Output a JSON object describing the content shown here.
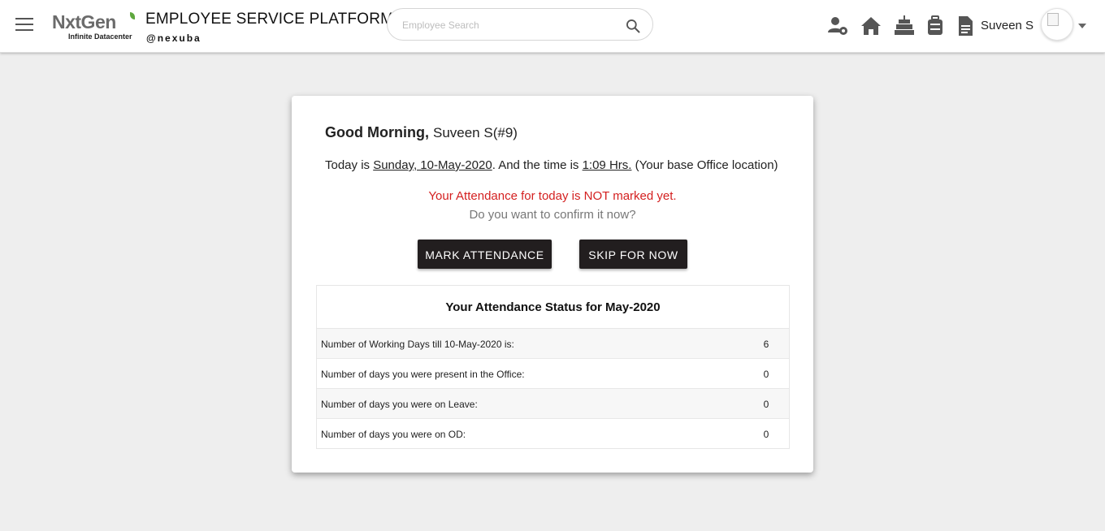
{
  "header": {
    "logo_main": "NxtGen",
    "logo_tagline": "Infinite Datacenter",
    "title": "EMPLOYEE SERVICE PLATFORM",
    "subtitle": "@nexuba",
    "search_placeholder": "Employee Search",
    "search_value": "",
    "user_name": "Suveen S",
    "icons": [
      "user-settings-icon",
      "home-icon",
      "birthday-cake-icon",
      "luggage-icon",
      "document-icon"
    ]
  },
  "card": {
    "greeting": "Good Morning,",
    "employee": "Suveen S(#9)",
    "today_prefix": "Today is ",
    "date": "Sunday, 10-May-2020",
    "time_prefix": ". And the time is ",
    "time": "1:09 Hrs.",
    "location_note": " (Your base Office location)",
    "not_marked": "Your Attendance for today is NOT marked yet.",
    "confirm_question": "Do you want to confirm it now?",
    "mark_button": "MARK ATTENDANCE",
    "skip_button": "SKIP FOR NOW"
  },
  "status": {
    "title": "Your Attendance Status for May-2020",
    "rows": [
      {
        "label": "Number of Working Days till 10-May-2020 is:",
        "value": "6"
      },
      {
        "label": "Number of days you were present in the Office:",
        "value": "0"
      },
      {
        "label": "Number of days you were on Leave:",
        "value": "0"
      },
      {
        "label": "Number of days you were on OD:",
        "value": "0"
      }
    ]
  },
  "colors": {
    "background": "#eeeeee",
    "button": "#221e1f",
    "alert": "#d42020",
    "brand_green": "#5ea73d",
    "brand_gray": "#6b6b6b"
  }
}
